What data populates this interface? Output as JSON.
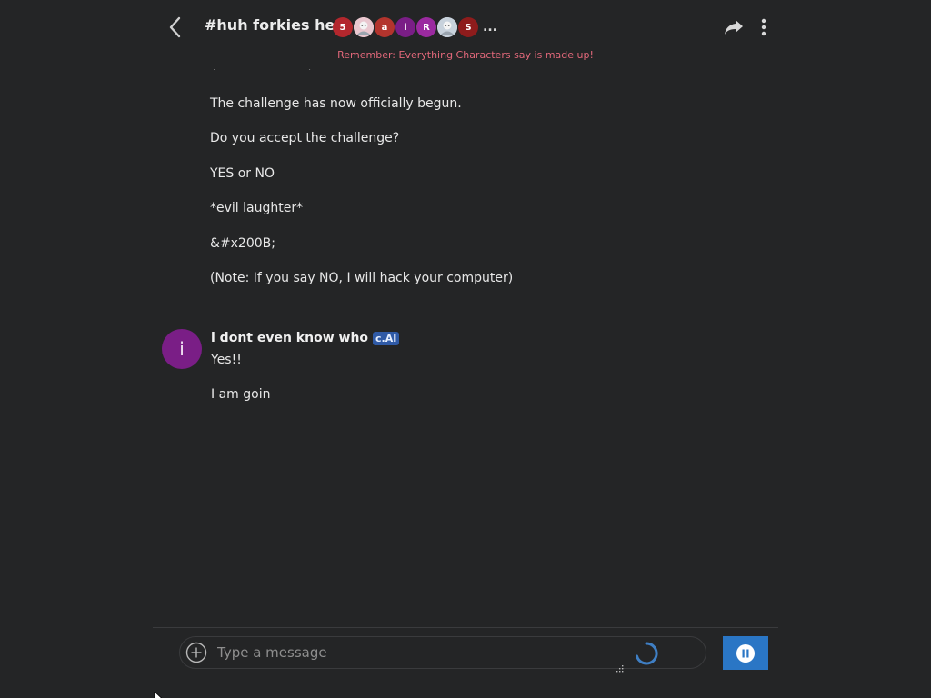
{
  "header": {
    "title": "#huh forkies here",
    "participants": [
      {
        "label": "5",
        "color": "#b3272d"
      },
      {
        "label": "",
        "color": "#e9c7cf",
        "image": true
      },
      {
        "label": "a",
        "color": "#b3342d"
      },
      {
        "label": "i",
        "color": "#7a1e86"
      },
      {
        "label": "R",
        "color": "#9b2aa0"
      },
      {
        "label": "",
        "color": "#c8d2dc",
        "image": true
      },
      {
        "label": "S",
        "color": "#8e1c1c"
      }
    ],
    "participants_more": "...",
    "disclaimer": "Remember: Everything Characters say is made up!"
  },
  "messages": {
    "previous_lines": [
      "The challenge has now officially begun.",
      "Do you accept the challenge?",
      "YES or NO",
      "*evil laughter*",
      "&#x200B;",
      "(Note: If you say NO, I will hack your computer)"
    ],
    "bot": {
      "avatar_letter": "i",
      "avatar_color": "#7a1e86",
      "name": "i dont even know who",
      "badge": "c.AI",
      "lines": [
        "Yes!!",
        "I am goin"
      ]
    }
  },
  "composer": {
    "placeholder": "Type a message",
    "value": ""
  },
  "colors": {
    "accent": "#2a76c5",
    "disclaimer": "#e2687a",
    "background": "#242526"
  }
}
